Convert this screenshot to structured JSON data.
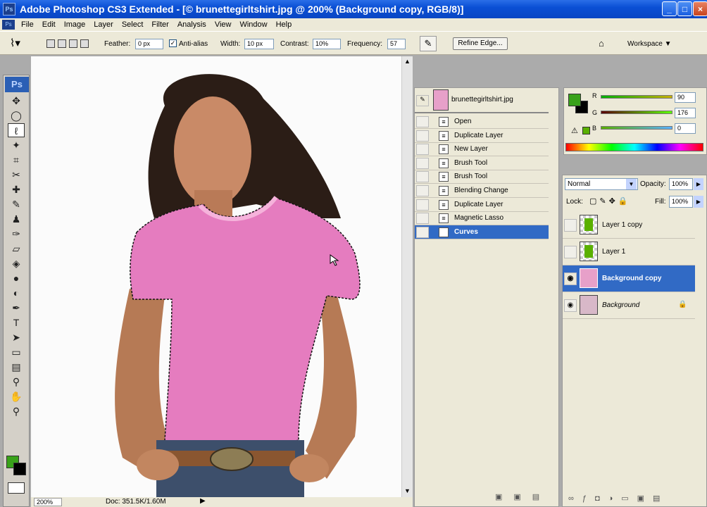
{
  "window": {
    "title": "Adobe Photoshop CS3 Extended - [© brunettegirltshirt.jpg @ 200% (Background copy, RGB/8)]",
    "app_icon": "Ps",
    "buttons": {
      "minimize": "_",
      "maximize": "□",
      "close": "×"
    }
  },
  "menu": {
    "items": [
      "File",
      "Edit",
      "Image",
      "Layer",
      "Select",
      "Filter",
      "Analysis",
      "View",
      "Window",
      "Help"
    ]
  },
  "options": {
    "feather_label": "Feather:",
    "feather_value": "0 px",
    "antialias_label": "Anti-alias",
    "width_label": "Width:",
    "width_value": "10 px",
    "contrast_label": "Contrast:",
    "contrast_value": "10%",
    "frequency_label": "Frequency:",
    "frequency_value": "57",
    "refine_edge": "Refine Edge...",
    "workspace": "Workspace ▼"
  },
  "toolbox": {
    "badge": "Ps",
    "foreground_color": "#39a21a",
    "background_color": "#000000"
  },
  "statusbar": {
    "zoom": "200%",
    "doc": "Doc: 351.5K/1.60M"
  },
  "history": {
    "snapshot_name": "brunettegirltshirt.jpg",
    "items": [
      "Open",
      "Duplicate Layer",
      "New Layer",
      "Brush Tool",
      "Brush Tool",
      "Blending Change",
      "Duplicate Layer",
      "Magnetic Lasso",
      "Curves"
    ],
    "selected_index": 8
  },
  "color": {
    "r_label": "R",
    "r_value": "90",
    "g_label": "G",
    "g_value": "176",
    "b_label": "B",
    "b_value": "0",
    "swatch": "#5ab000"
  },
  "layers": {
    "blend_mode": "Normal",
    "opacity_label": "Opacity:",
    "opacity_value": "100%",
    "lock_label": "Lock:",
    "fill_label": "Fill:",
    "fill_value": "100%",
    "items": [
      {
        "name": "Layer 1 copy",
        "visible": false
      },
      {
        "name": "Layer 1",
        "visible": false
      },
      {
        "name": "Background copy",
        "visible": true,
        "selected": true
      },
      {
        "name": "Background",
        "visible": true,
        "locked": true
      }
    ]
  }
}
